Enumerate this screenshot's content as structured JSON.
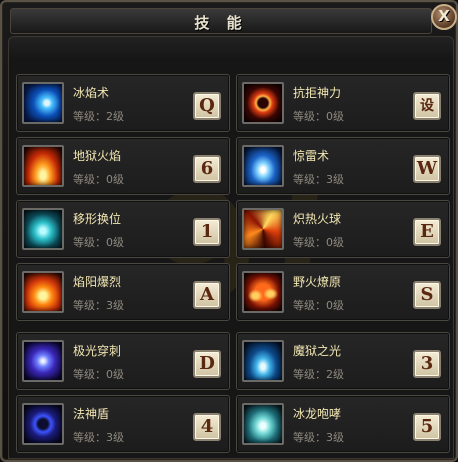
{
  "window": {
    "title": "技 能",
    "close_label": "X"
  },
  "colors": {
    "name": "#f2e7b3",
    "level": "#8f8a80",
    "key_bg": "#e8dfc4",
    "key_text": "#5a2810"
  },
  "skills": [
    {
      "name": "冰焰术",
      "level": "等级：2级",
      "key": "Q",
      "icon": "ice-flame-icon"
    },
    {
      "name": "抗拒神力",
      "level": "等级：0级",
      "key": "设",
      "icon": "fire-ring-icon"
    },
    {
      "name": "地狱火焰",
      "level": "等级：0级",
      "key": "6",
      "icon": "hellfire-icon"
    },
    {
      "name": "惊雷术",
      "level": "等级：3级",
      "key": "W",
      "icon": "thunder-icon"
    },
    {
      "name": "移形换位",
      "level": "等级：0级",
      "key": "1",
      "icon": "teleport-icon"
    },
    {
      "name": "炽热火球",
      "level": "等级：0级",
      "key": "E",
      "icon": "fireball-icon"
    },
    {
      "name": "焰阳爆烈",
      "level": "等级：3级",
      "key": "A",
      "icon": "flame-burst-icon"
    },
    {
      "name": "野火燎原",
      "level": "等级：0级",
      "key": "S",
      "icon": "wildfire-icon"
    },
    {
      "name": "极光穿刺",
      "level": "等级：0级",
      "key": "D",
      "icon": "aurora-pierce-icon"
    },
    {
      "name": "魔狱之光",
      "level": "等级：2级",
      "key": "3",
      "icon": "demon-light-icon"
    },
    {
      "name": "法神盾",
      "level": "等级：3级",
      "key": "4",
      "icon": "mage-shield-icon"
    },
    {
      "name": "冰龙咆哮",
      "level": "等级：3级",
      "key": "5",
      "icon": "ice-dragon-icon"
    }
  ]
}
